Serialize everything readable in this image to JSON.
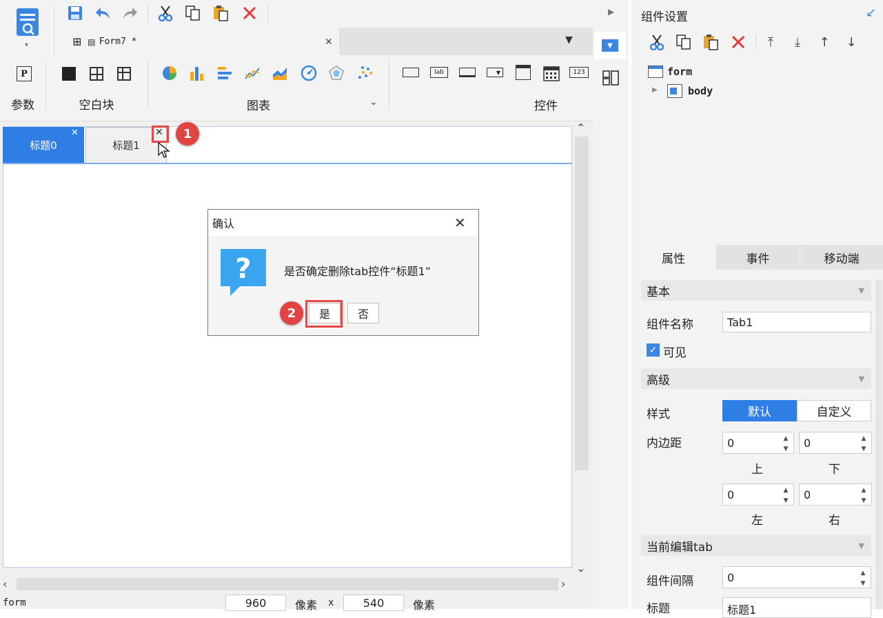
{
  "toolbar": {
    "doc_tab_label": "Form7 *"
  },
  "ribbon": {
    "param_label": "参数",
    "blank_label": "空白块",
    "chart_label": "图表",
    "widget_label": "控件",
    "lab_text": "lab",
    "num_text": "123",
    "p_text": "P"
  },
  "canvas": {
    "tab0": "标题0",
    "tab1": "标题1",
    "badge1": "1",
    "badge2": "2"
  },
  "dialog": {
    "title": "确认",
    "message": "是否确定删除tab控件“标题1”",
    "yes": "是",
    "no": "否"
  },
  "status": {
    "name": "form",
    "width": "960",
    "unit1": "像素",
    "x": "x",
    "height": "540",
    "unit2": "像素"
  },
  "panel": {
    "title": "组件设置",
    "tree_form": "form",
    "tree_body": "body",
    "tabs": [
      "属性",
      "事件",
      "移动端"
    ],
    "basic": "基本",
    "name_label": "组件名称",
    "name_value": "Tab1",
    "visible_label": "可见",
    "advanced": "高级",
    "style_label": "样式",
    "style_default": "默认",
    "style_custom": "自定义",
    "padding_label": "内边距",
    "pad_top": "0",
    "pad_bottom": "0",
    "pad_left": "0",
    "pad_right": "0",
    "lbl_top": "上",
    "lbl_bottom": "下",
    "lbl_left": "左",
    "lbl_right": "右",
    "current_tab": "当前编辑tab",
    "gap_label": "组件间隔",
    "gap_value": "0",
    "title_label": "标题",
    "title_value": "标题1"
  },
  "colors": {
    "accent": "#2f7ee6",
    "highlight": "#e54646"
  }
}
